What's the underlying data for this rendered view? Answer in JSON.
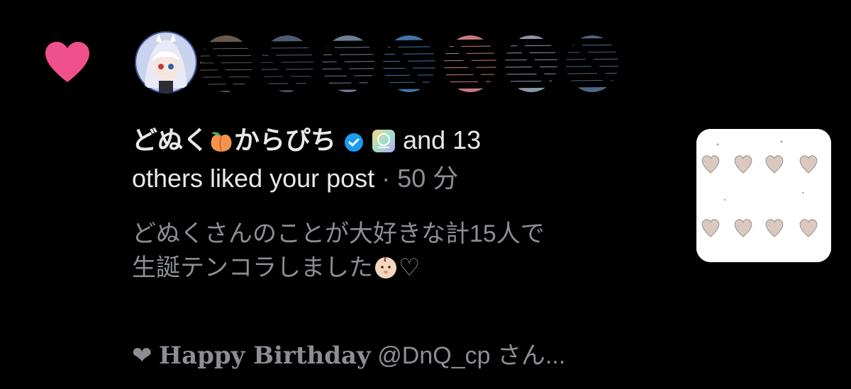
{
  "notification": {
    "type_icon": "heart-icon",
    "accent_color": "#f0508c",
    "actor_name_part1": "どぬく",
    "actor_emoji": "peach-icon",
    "actor_name_part2": "からぴち",
    "verified_badge": "verified-badge-icon",
    "suffix_count": "and 13",
    "suffix_text": "others liked your post",
    "time_sep": "·",
    "time": "50 分"
  },
  "post": {
    "line1": "どぬくさんのことが大好きな計15人で",
    "line2": "生誕テンコラしました",
    "line2_emoji": "baby-face-icon",
    "line2_tail": "♡"
  },
  "reply": {
    "heart_glyph": "❤",
    "highlight": "Happy Birthday",
    "rest": "@DnQ_cp さん..."
  }
}
